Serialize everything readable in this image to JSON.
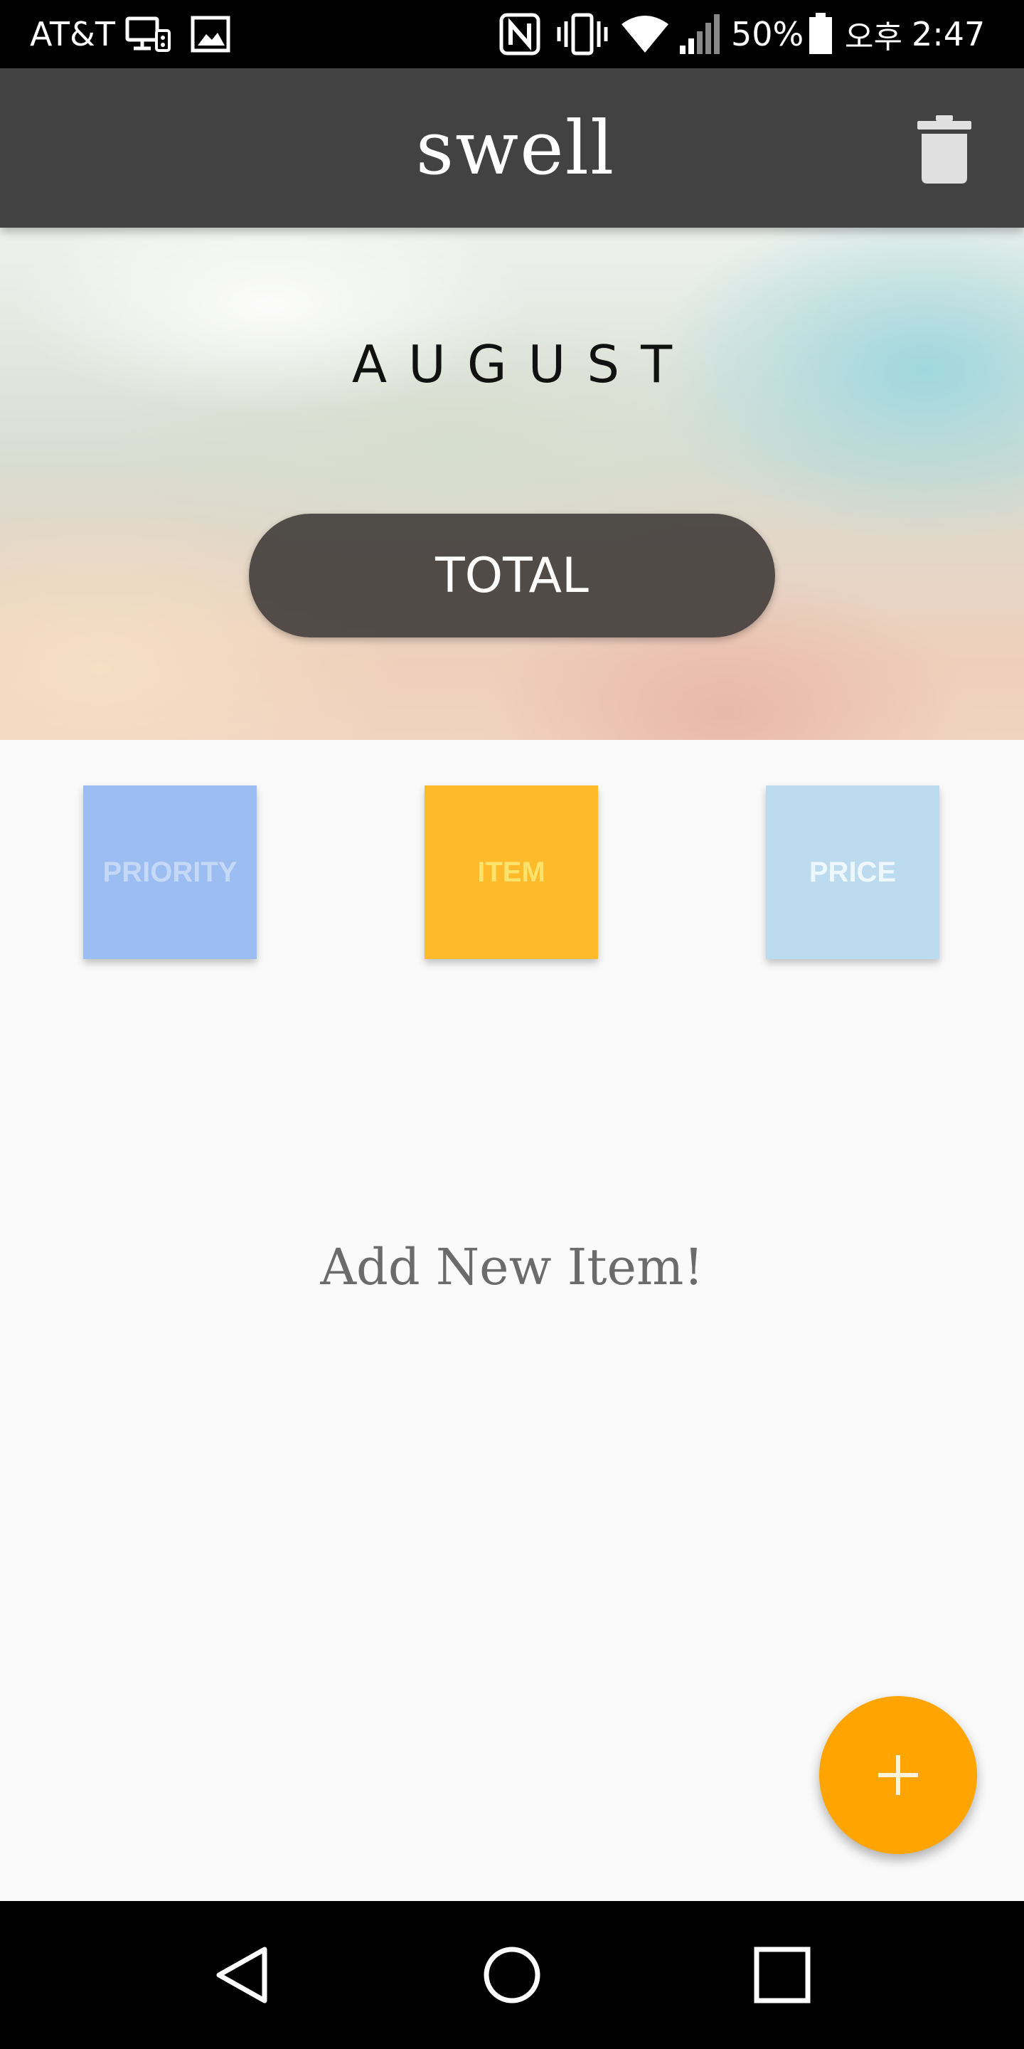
{
  "status_bar": {
    "carrier": "AT&T",
    "battery_percent": "50%",
    "ampm": "오후",
    "time": "2:47",
    "icons": [
      "screen-mirror-icon",
      "image-icon",
      "nfc-icon",
      "vibrate-icon",
      "wifi-icon",
      "signal-icon",
      "battery-icon"
    ]
  },
  "app_bar": {
    "logo": "swell",
    "trash_icon": "trash-icon"
  },
  "hero": {
    "month": "AUGUST",
    "total_label": "TOTAL"
  },
  "sort_buttons": {
    "priority": "PRIORITY",
    "item": "ITEM",
    "price": "PRICE",
    "colors": {
      "priority": "#9cbdf2",
      "item": "#ffba2c",
      "price": "#bcdbef"
    }
  },
  "empty_state": {
    "message": "Add New Item!"
  },
  "fab": {
    "icon": "plus-icon",
    "color": "#ffa400"
  },
  "nav_bar": {
    "icons": [
      "back-icon",
      "home-icon",
      "recents-icon"
    ]
  }
}
